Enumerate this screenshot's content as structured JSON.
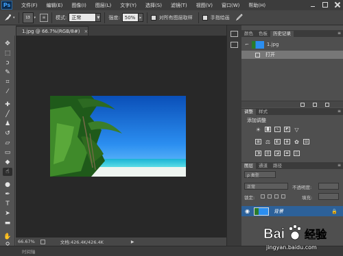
{
  "menubar": {
    "logo": "Ps",
    "items": [
      "文件(F)",
      "编辑(E)",
      "图像(I)",
      "图层(L)",
      "文字(Y)",
      "选择(S)",
      "滤镜(T)",
      "视图(V)",
      "窗口(W)",
      "帮助(H)"
    ]
  },
  "options": {
    "brush_size": "13",
    "mode_label": "模式:",
    "mode_value": "正常",
    "strength_label": "强度:",
    "strength_value": "50%",
    "sample_all_label": "对所有图层取样",
    "finger_paint_label": "手指绘画"
  },
  "document": {
    "tab_title": "1.jpg @ 66.7%(RGB/8#)",
    "close_glyph": "×"
  },
  "status": {
    "zoom": "66.67%",
    "doc_info": "文档:426.4K/426.4K"
  },
  "bottom": {
    "timeline_label": "时间轴"
  },
  "history_panel": {
    "tabs": [
      "颜色",
      "色板",
      "历史记录"
    ],
    "snapshot_name": "1.jpg",
    "step_name": "打开"
  },
  "adjustments_panel": {
    "tabs": [
      "调整",
      "样式"
    ],
    "title": "添加调整"
  },
  "layers_panel": {
    "tabs": [
      "图层",
      "通道",
      "路径"
    ],
    "kind_label": "ρ 类型",
    "blend_mode": "正常",
    "opacity_label": "不透明度:",
    "lock_label": "锁定:",
    "fill_label": "填充:",
    "layer_name": "背景"
  },
  "watermark": {
    "brand_a": "Bai",
    "brand_b": "经验",
    "url": "jingyan.baidu.com"
  },
  "colors": {
    "accent_blue": "#2d6199",
    "canvas_bg": "#282828",
    "panel_bg": "#4f4f4f"
  }
}
